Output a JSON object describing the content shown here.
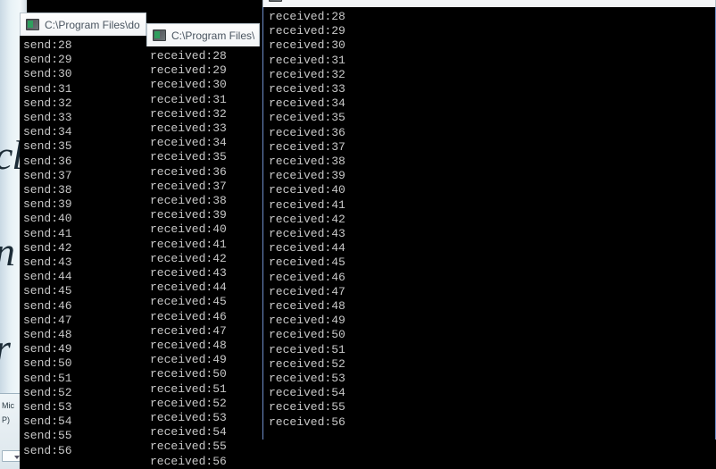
{
  "desktop": {
    "background_app": {
      "glyph_text": "cl\nn\nr",
      "panel_label": "Mic",
      "panel_sublabel": "P)",
      "combo_value": ""
    }
  },
  "windows": [
    {
      "id": "win1",
      "title": "C:\\Program Files\\do",
      "icon": "console-icon",
      "lines": [
        "send:28",
        "send:29",
        "send:30",
        "send:31",
        "send:32",
        "send:33",
        "send:34",
        "send:35",
        "send:36",
        "send:37",
        "send:38",
        "send:39",
        "send:40",
        "send:41",
        "send:42",
        "send:43",
        "send:44",
        "send:45",
        "send:46",
        "send:47",
        "send:48",
        "send:49",
        "send:50",
        "send:51",
        "send:52",
        "send:53",
        "send:54",
        "send:55",
        "send:56"
      ]
    },
    {
      "id": "win2",
      "title": "C:\\Program Files\\",
      "icon": "console-icon",
      "lines": [
        "received:28",
        "received:29",
        "received:30",
        "received:31",
        "received:32",
        "received:33",
        "received:34",
        "received:35",
        "received:36",
        "received:37",
        "received:38",
        "received:39",
        "received:40",
        "received:41",
        "received:42",
        "received:43",
        "received:44",
        "received:45",
        "received:46",
        "received:47",
        "received:48",
        "received:49",
        "received:50",
        "received:51",
        "received:52",
        "received:53",
        "received:54",
        "received:55",
        "received:56"
      ]
    },
    {
      "id": "win3",
      "title": "",
      "icon": "console-icon",
      "lines": [
        "received:28",
        "received:29",
        "received:30",
        "received:31",
        "received:32",
        "received:33",
        "received:34",
        "received:35",
        "received:36",
        "received:37",
        "received:38",
        "received:39",
        "received:40",
        "received:41",
        "received:42",
        "received:43",
        "received:44",
        "received:45",
        "received:46",
        "received:47",
        "received:48",
        "received:49",
        "received:50",
        "received:51",
        "received:52",
        "received:53",
        "received:54",
        "received:55",
        "received:56"
      ]
    }
  ],
  "colors": {
    "console_bg": "#000000",
    "console_fg": "#c8c8c8",
    "titlebar_bg": "#f7f8fa",
    "titlebar_text": "#4a5560",
    "active_border": "#6f8ecb"
  }
}
